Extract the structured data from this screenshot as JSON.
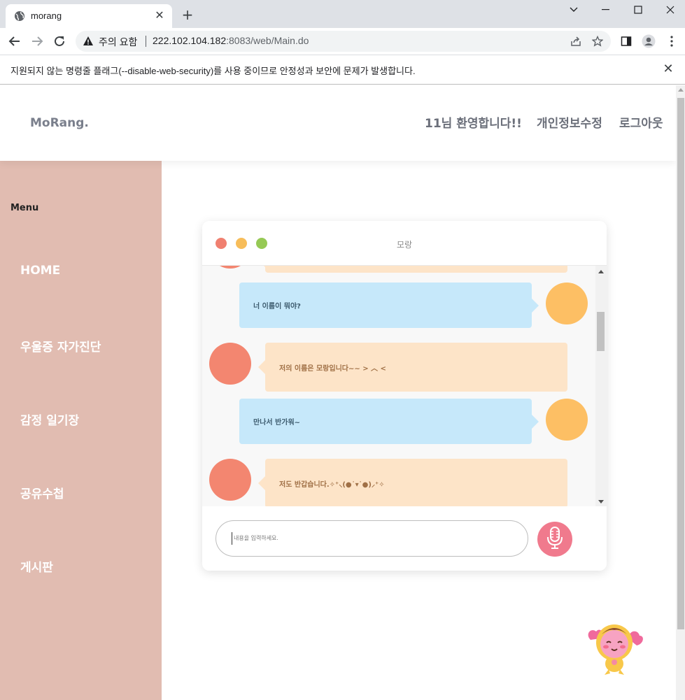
{
  "browser": {
    "tab_title": "morang",
    "omnibox_warning": "주의 요함",
    "url_host": "222.102.104.182",
    "url_path": ":8083/web/Main.do",
    "infobar_text": "지원되지 않는 명령줄 플래그(--disable-web-security)를 사용 중이므로 안정성과 보안에 문제가 발생합니다."
  },
  "header": {
    "logo": "MoRang.",
    "welcome": "11님 환영합니다!!",
    "edit_profile": "개인정보수정",
    "logout": "로그아웃"
  },
  "sidebar": {
    "title": "Menu",
    "items": [
      "HOME",
      "우울증 자가진단",
      "감정 일기장",
      "공유수첩",
      "게시판"
    ]
  },
  "chat": {
    "title": "모랑",
    "messages": [
      {
        "from": "me",
        "text": "너 이름이 뭐야?"
      },
      {
        "from": "bot",
        "text": "저의 이름은 모랑입니다~~ > ︿ <"
      },
      {
        "from": "me",
        "text": "만나서 반가워~"
      },
      {
        "from": "bot",
        "text": "저도 반갑습니다.✧⁺⸜(●˙▾˙●)⸝⁺✧"
      }
    ],
    "input_placeholder": "내용을 입력하세요."
  },
  "colors": {
    "sidebar_bg": "#e1bcb1",
    "dot_red": "#f08070",
    "dot_yellow": "#f7bd5a",
    "dot_green": "#96c955",
    "user_bubble": "#c6e8fa",
    "bot_bubble": "#fde4c8",
    "user_avatar": "#fdbf64",
    "bot_avatar": "#f38670",
    "mic_button": "#f07a8d"
  }
}
